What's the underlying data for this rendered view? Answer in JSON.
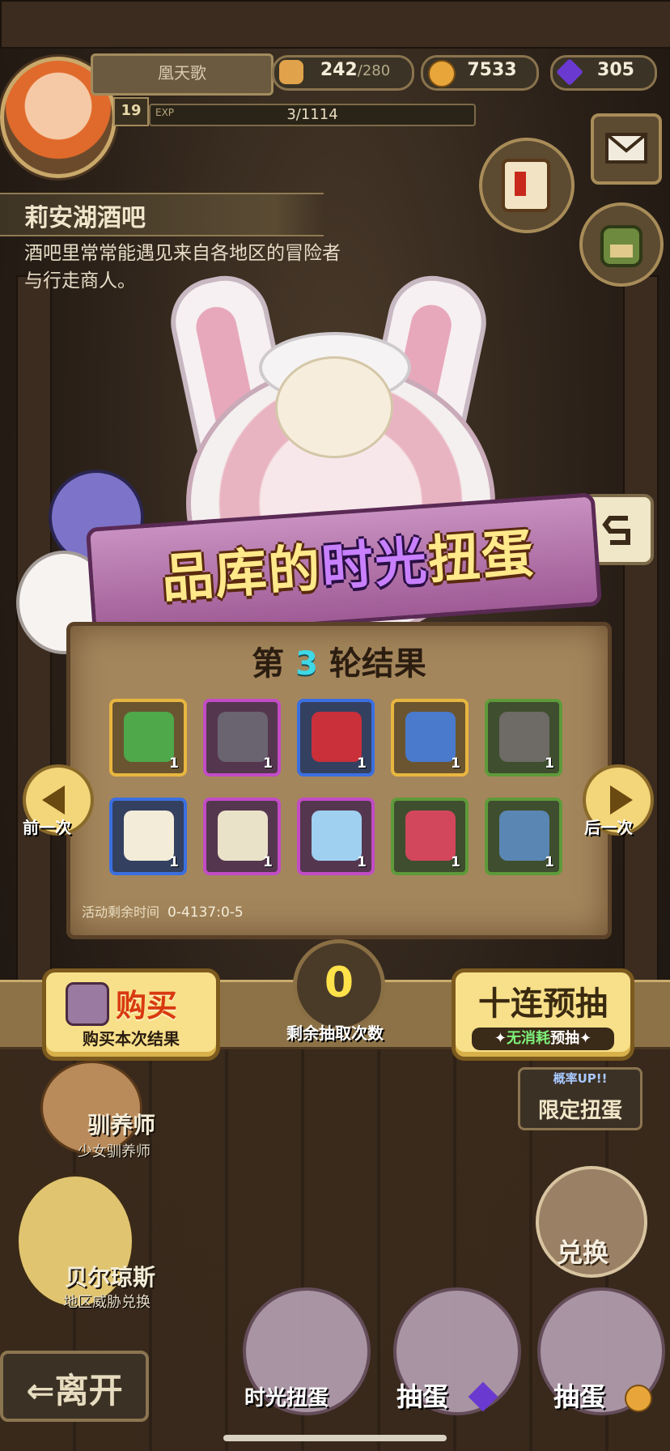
{
  "player": {
    "name": "凰天歌",
    "level": "19",
    "exp_label": "EXP",
    "exp_value": "3/1114"
  },
  "resources": {
    "stamina_current": "242",
    "stamina_max": "/280",
    "gold": "7533",
    "gems": "305"
  },
  "location": {
    "title": "莉安湖酒吧",
    "description": "酒吧里常常能遇见来自各地区的冒险者与行走商人。"
  },
  "gacha": {
    "title_part1": "品库的",
    "title_highlight": "时光",
    "title_part2": "扭蛋",
    "round_prefix": "第",
    "round_number": "3",
    "round_suffix": "轮结果",
    "timer_label": "活动剩余时间",
    "timer_value": "0-4137:0-5",
    "items": [
      {
        "name": "lantern-item-icon",
        "rarity": "gold",
        "qty": "1",
        "color": "#4fa84a"
      },
      {
        "name": "kunai-item-icon",
        "rarity": "purple",
        "qty": "1",
        "color": "#6a6470"
      },
      {
        "name": "helmet-item-icon",
        "rarity": "blue",
        "qty": "1",
        "color": "#c9303a"
      },
      {
        "name": "beast-helmet-item-icon",
        "rarity": "gold",
        "qty": "1",
        "color": "#4a7acc"
      },
      {
        "name": "stone-item-icon",
        "rarity": "green",
        "qty": "1",
        "color": "#6e6a66"
      },
      {
        "name": "wool-item-icon",
        "rarity": "blue",
        "qty": "1",
        "color": "#f2ecd8"
      },
      {
        "name": "nest-egg-item-icon",
        "rarity": "purple",
        "qty": "1",
        "color": "#e9e2c8"
      },
      {
        "name": "wings-item-icon",
        "rarity": "purple",
        "qty": "1",
        "color": "#9fd0f0"
      },
      {
        "name": "red-egg-item-icon",
        "rarity": "green",
        "qty": "1",
        "color": "#d2475c"
      },
      {
        "name": "seed-item-icon",
        "rarity": "green",
        "qty": "1",
        "color": "#5a86b4"
      }
    ],
    "prev_label": "前一次",
    "next_label": "后一次",
    "buy_label": "购买",
    "buy_sub": "购买本次结果",
    "remaining_count": "0",
    "remaining_label": "剩余抽取次数",
    "ten_label": "十连预抽",
    "ten_sub_green": "无消耗",
    "ten_sub_white": "预抽"
  },
  "side_menu": {
    "limited_top": "概率UP!!",
    "limited_main": "限定扭蛋",
    "exchange": "兑换"
  },
  "npcs": [
    {
      "name": "驯养师",
      "sub": "少女驯养师"
    },
    {
      "name": "贝尔琼斯",
      "sub": "地区威胁兑换"
    }
  ],
  "bottom": {
    "leave": "离开",
    "slot1": "时光扭蛋",
    "slot2": "抽蛋",
    "slot3": "抽蛋"
  }
}
